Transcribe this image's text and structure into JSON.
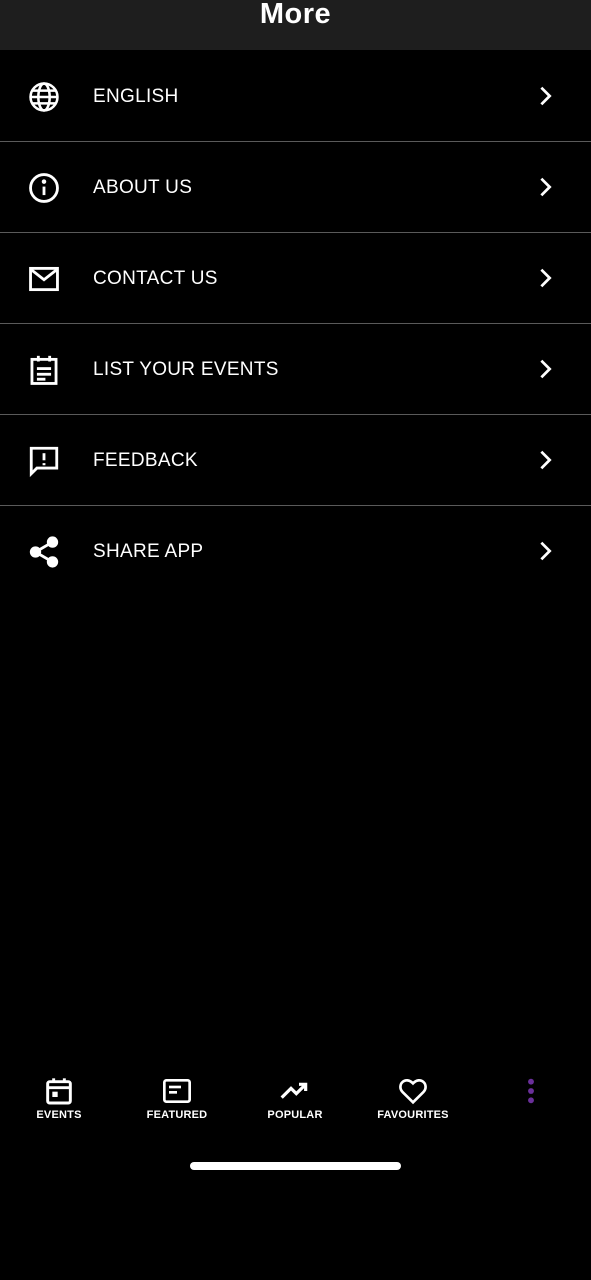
{
  "header": {
    "title": "More"
  },
  "menu": {
    "items": [
      {
        "label": "ENGLISH",
        "icon": "globe-icon"
      },
      {
        "label": "ABOUT US",
        "icon": "info-icon"
      },
      {
        "label": "CONTACT US",
        "icon": "mail-icon"
      },
      {
        "label": "LIST YOUR EVENTS",
        "icon": "event-note-icon"
      },
      {
        "label": "FEEDBACK",
        "icon": "feedback-icon"
      },
      {
        "label": "SHARE APP",
        "icon": "share-icon"
      }
    ]
  },
  "bottom_nav": {
    "items": [
      {
        "label": "EVENTS",
        "icon": "calendar-icon"
      },
      {
        "label": "FEATURED",
        "icon": "featured-icon"
      },
      {
        "label": "POPULAR",
        "icon": "trending-up-icon"
      },
      {
        "label": "FAVOURITES",
        "icon": "heart-icon"
      },
      {
        "label": "",
        "icon": "more-vertical-icon",
        "active": true
      }
    ]
  },
  "colors": {
    "background": "#000000",
    "header_background": "#1e1e1e",
    "divider": "#5a5a5a",
    "text": "#ffffff",
    "accent": "#6a2f9a"
  }
}
